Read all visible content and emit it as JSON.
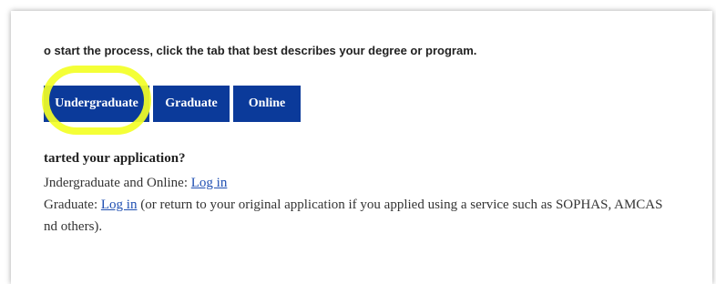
{
  "intro": "o start the process, click the tab that best describes your degree or program.",
  "tabs": [
    {
      "label": "Undergraduate"
    },
    {
      "label": "Graduate"
    },
    {
      "label": "Online"
    }
  ],
  "started": {
    "question": "tarted your application?",
    "line1_prefix": "Jndergraduate and Online: ",
    "line1_link": "Log in",
    "line2_prefix": "Graduate: ",
    "line2_link": "Log in",
    "line2_suffix": " (or return to your original application if you applied using a service such as SOPHAS, AMCAS",
    "line3": "nd others)."
  },
  "colors": {
    "tab_bg": "#0b3a9a",
    "highlight": "#f3ff26",
    "link": "#1f4fb2"
  }
}
